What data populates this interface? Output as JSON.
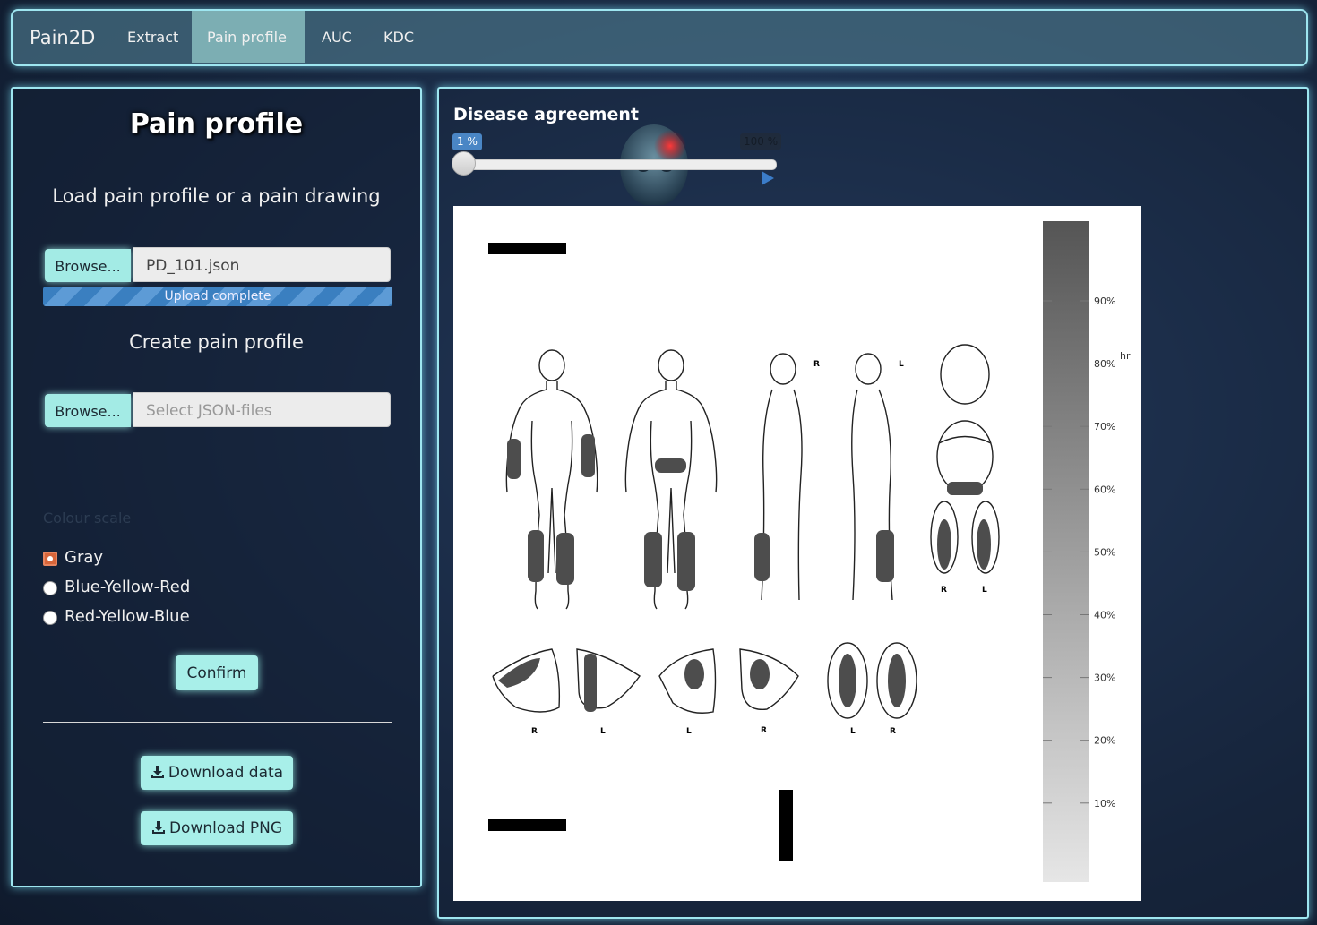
{
  "navbar": {
    "brand": "Pain2D",
    "tabs": [
      {
        "label": "Extract",
        "active": false
      },
      {
        "label": "Pain profile",
        "active": true
      },
      {
        "label": "AUC",
        "active": false
      },
      {
        "label": "KDC",
        "active": false
      }
    ]
  },
  "left_panel": {
    "title": "Pain profile",
    "load_label": "Load pain profile or a pain drawing",
    "load_browse_label": "Browse...",
    "load_file_value": "PD_101.json",
    "upload_status": "Upload complete",
    "create_label": "Create pain profile",
    "create_browse_label": "Browse...",
    "create_file_placeholder": "Select JSON-files",
    "color_scheme_label": "Colour scale",
    "color_options": [
      "Gray",
      "Blue-Yellow-Red",
      "Red-Yellow-Blue"
    ],
    "color_selected": "Gray",
    "confirm_label": "Confirm",
    "download_data_label": "Download data",
    "download_png_label": "Download PNG"
  },
  "right_panel": {
    "title": "Disease agreement",
    "slider": {
      "value_label": "1 %",
      "max_label": "100 %",
      "value": 1,
      "min": 1,
      "max": 100
    },
    "colorbar": {
      "ticks": [
        "90%",
        "80%",
        "70%",
        "60%",
        "50%",
        "40%",
        "30%",
        "20%",
        "10%"
      ],
      "label": "hr",
      "top_color": "#555555",
      "bottom_color": "#e6e6e6"
    },
    "figure_letters": {
      "side_right": "R",
      "side_left": "L",
      "feet_r": "R",
      "feet_l": "L",
      "hand1": "R",
      "hand2": "L",
      "hand3": "L",
      "hand4": "R",
      "sole1": "L",
      "sole2": "R"
    }
  },
  "colors": {
    "accent": "#a8efe9",
    "panel_border": "#9ee6f0",
    "pain_fill": "#4d4d4d"
  }
}
